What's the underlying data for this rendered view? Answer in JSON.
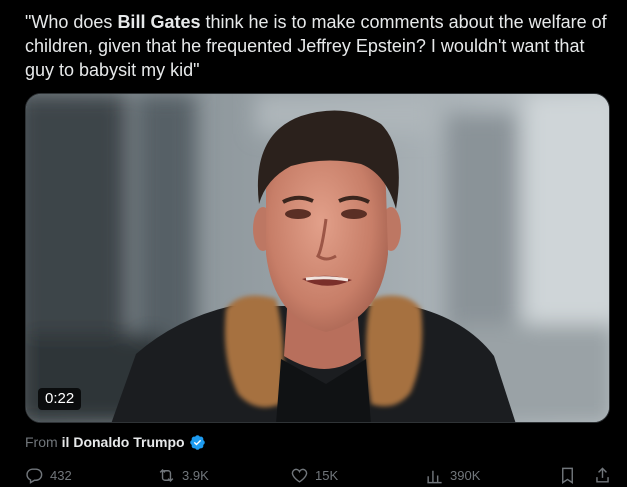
{
  "tweet": {
    "text_before": "\"Who does ",
    "text_bold": "Bill Gates",
    "text_after": " think he is to make comments about the welfare of children, given that he frequented Jeffrey Epstein? I wouldn't want that guy to babysit my kid\""
  },
  "media": {
    "duration": "0:22"
  },
  "source": {
    "from_label": "From",
    "author": "il Donaldo Trumpo",
    "verified_color": "#1d9bf0"
  },
  "actions": {
    "replies": "432",
    "reposts": "3.9K",
    "likes": "15K",
    "views": "390K"
  },
  "colors": {
    "background": "#000000",
    "text": "#e7e9ea",
    "muted": "#71767b",
    "accent": "#1d9bf0"
  },
  "icons": [
    "reply-icon",
    "retweet-icon",
    "like-icon",
    "views-icon",
    "bookmark-icon",
    "share-icon",
    "verified-badge-icon"
  ]
}
